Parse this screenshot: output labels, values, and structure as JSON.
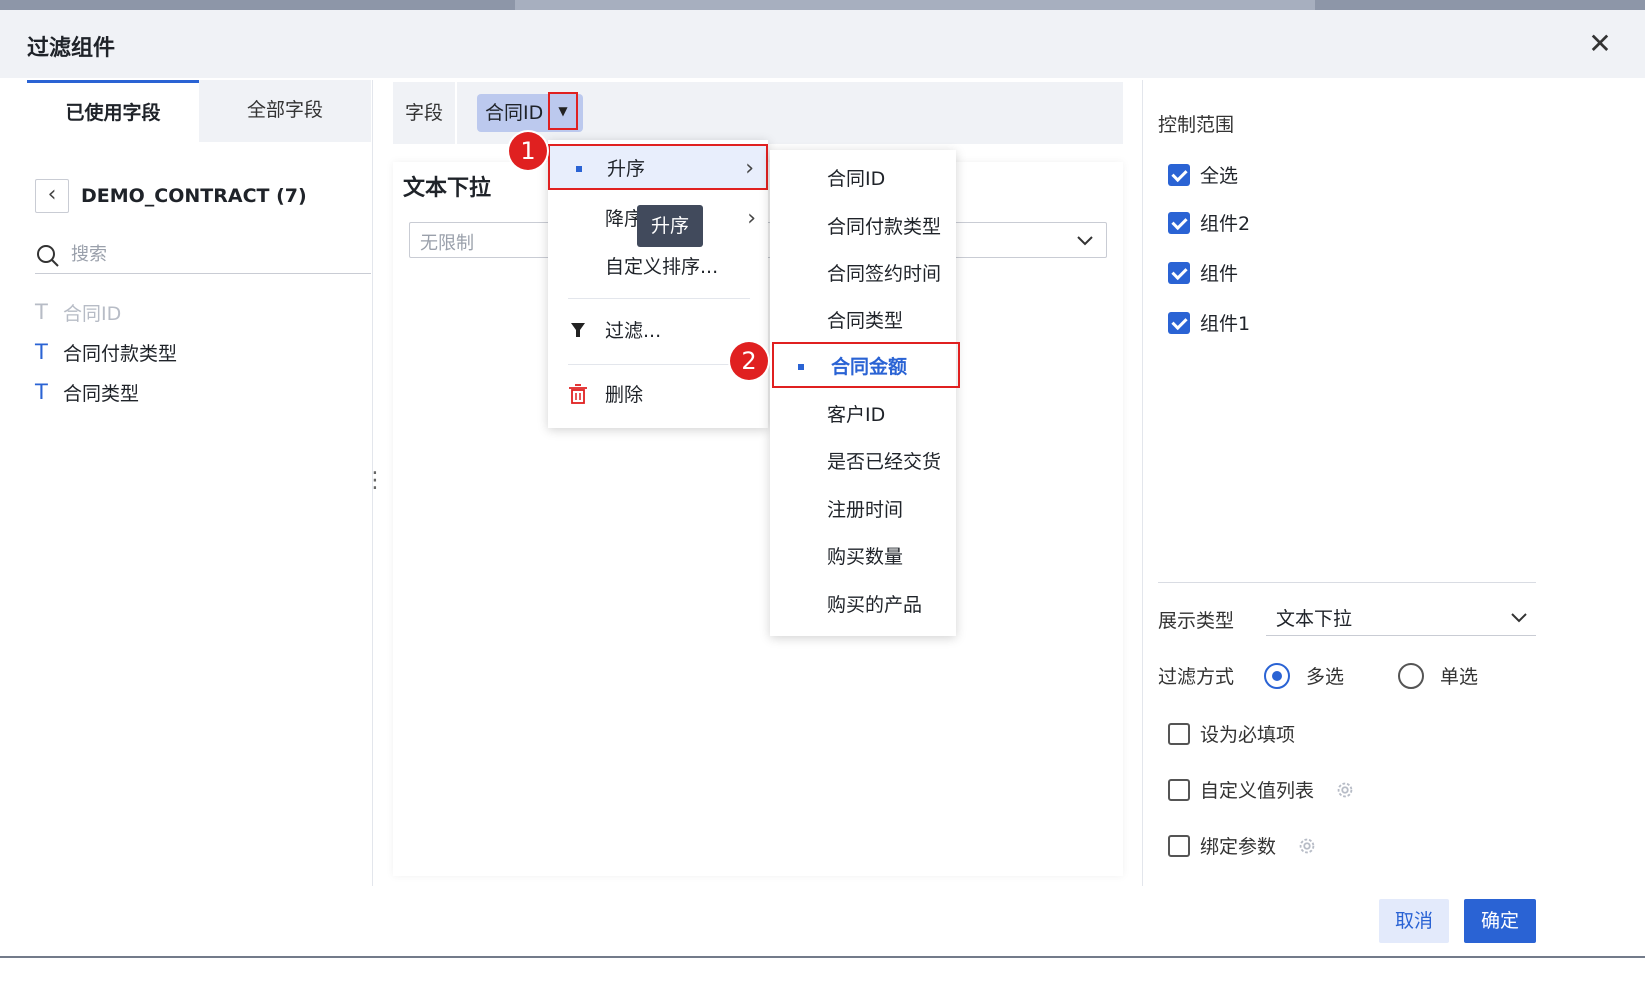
{
  "dialog": {
    "title": "过滤组件"
  },
  "left": {
    "tabs": [
      "已使用字段",
      "全部字段"
    ],
    "dataset": "DEMO_CONTRACT (7)",
    "search_placeholder": "搜索",
    "fields": [
      {
        "label": "合同ID",
        "disabled": true
      },
      {
        "label": "合同付款类型",
        "disabled": false
      },
      {
        "label": "合同类型",
        "disabled": false
      }
    ]
  },
  "middle": {
    "field_label": "字段",
    "chip": "合同ID",
    "preview_title": "文本下拉",
    "preview_placeholder": "无限制"
  },
  "menu": {
    "items": [
      "升序",
      "降序",
      "自定义排序...",
      "过滤...",
      "删除"
    ],
    "tooltip": "升序",
    "submenu": [
      "合同ID",
      "合同付款类型",
      "合同签约时间",
      "合同类型",
      "合同金额",
      "客户ID",
      "是否已经交货",
      "注册时间",
      "购买数量",
      "购买的产品"
    ],
    "selected": "合同金额"
  },
  "badges": [
    "1",
    "2"
  ],
  "right": {
    "scope_label": "控制范围",
    "scope_items": [
      "全选",
      "组件2",
      "组件",
      "组件1"
    ],
    "display_type_label": "展示类型",
    "display_type_value": "文本下拉",
    "filter_mode_label": "过滤方式",
    "filter_modes": [
      "多选",
      "单选"
    ],
    "options": [
      "设为必填项",
      "自定义值列表",
      "绑定参数"
    ]
  },
  "buttons": {
    "cancel": "取消",
    "ok": "确定"
  },
  "colors": {
    "accent": "#2a63d4",
    "highlight": "#e02020"
  }
}
